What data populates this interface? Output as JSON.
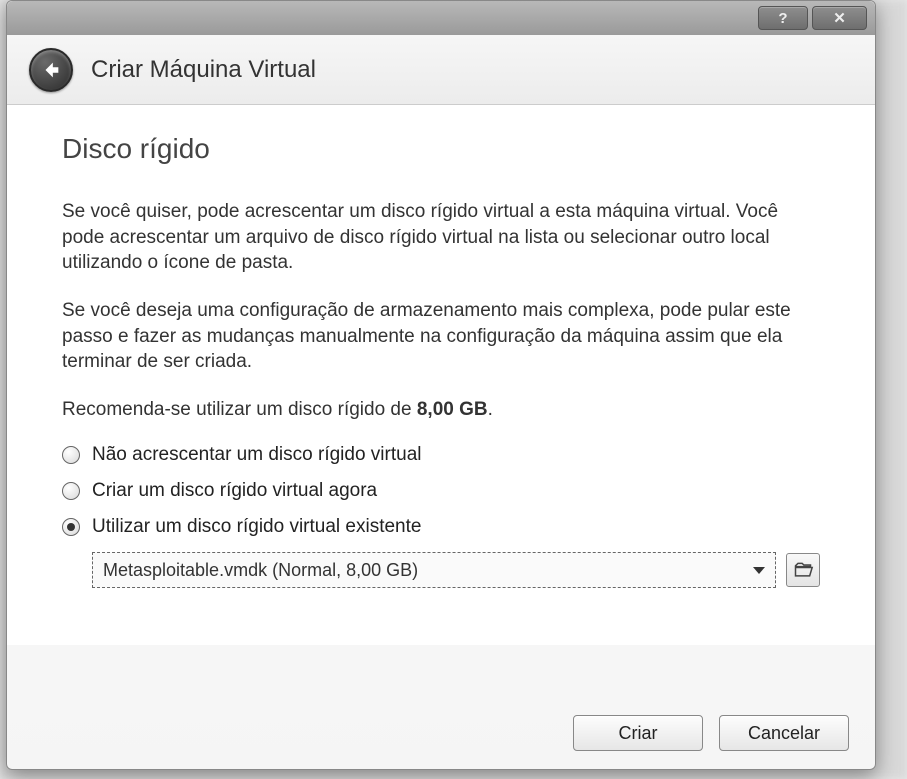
{
  "titlebar": {
    "help_glyph": "?",
    "close_glyph": "✕"
  },
  "header": {
    "title": "Criar Máquina Virtual"
  },
  "page": {
    "title": "Disco rígido",
    "para1": "Se você quiser, pode acrescentar um disco rígido virtual a esta máquina virtual. Você pode acrescentar um arquivo de disco rígido virtual na lista ou selecionar outro local utilizando o ícone de pasta.",
    "para2": "Se você deseja uma configuração de armazenamento mais complexa, pode pular este passo e fazer as mudanças manualmente na configuração da máquina assim que ela terminar de ser criada.",
    "rec_prefix": "Recomenda-se utilizar um disco rígido de ",
    "rec_size": "8,00 GB",
    "rec_suffix": "."
  },
  "options": {
    "opt1": "Não acrescentar um disco rígido virtual",
    "opt2": "Criar um disco rígido virtual agora",
    "opt3": "Utilizar um disco rígido virtual existente",
    "selected": "opt3",
    "combo_value": "Metasploitable.vmdk (Normal, 8,00 GB)"
  },
  "buttons": {
    "create": "Criar",
    "cancel": "Cancelar"
  }
}
